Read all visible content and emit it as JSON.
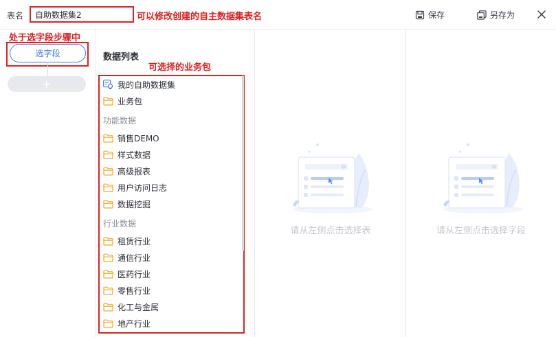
{
  "header": {
    "name_label": "表名",
    "name_value": "自助数据集2",
    "annotation": "可以修改创建的自主数据集表名",
    "save_label": "保存",
    "save_as_label": "另存为",
    "close_icon": "close-icon"
  },
  "steps": {
    "annotation": "处于选字段步骤中",
    "current_step_label": "选字段",
    "add_step_glyph": "+"
  },
  "data_list": {
    "title": "数据列表",
    "annotation": "可选择的业务包",
    "top_items": [
      {
        "label": "我的自助数据集",
        "icon": "my-dataset-icon"
      },
      {
        "label": "业务包",
        "icon": "folder-icon"
      }
    ],
    "groups": [
      {
        "label": "功能数据",
        "items": [
          "销售DEMO",
          "样式数据",
          "高级报表",
          "用户访问日志",
          "数据挖掘"
        ]
      },
      {
        "label": "行业数据",
        "items": [
          "租赁行业",
          "通信行业",
          "医药行业",
          "零售行业",
          "化工与金属",
          "地产行业"
        ]
      }
    ]
  },
  "empty_states": {
    "table_hint": "请从左侧点击选择表",
    "field_hint": "请从左侧点击选择字段"
  },
  "colors": {
    "accent": "#3d7be8",
    "annotation_red": "#e02020",
    "folder": "#f5a623",
    "muted_text": "#c3c7ce"
  }
}
